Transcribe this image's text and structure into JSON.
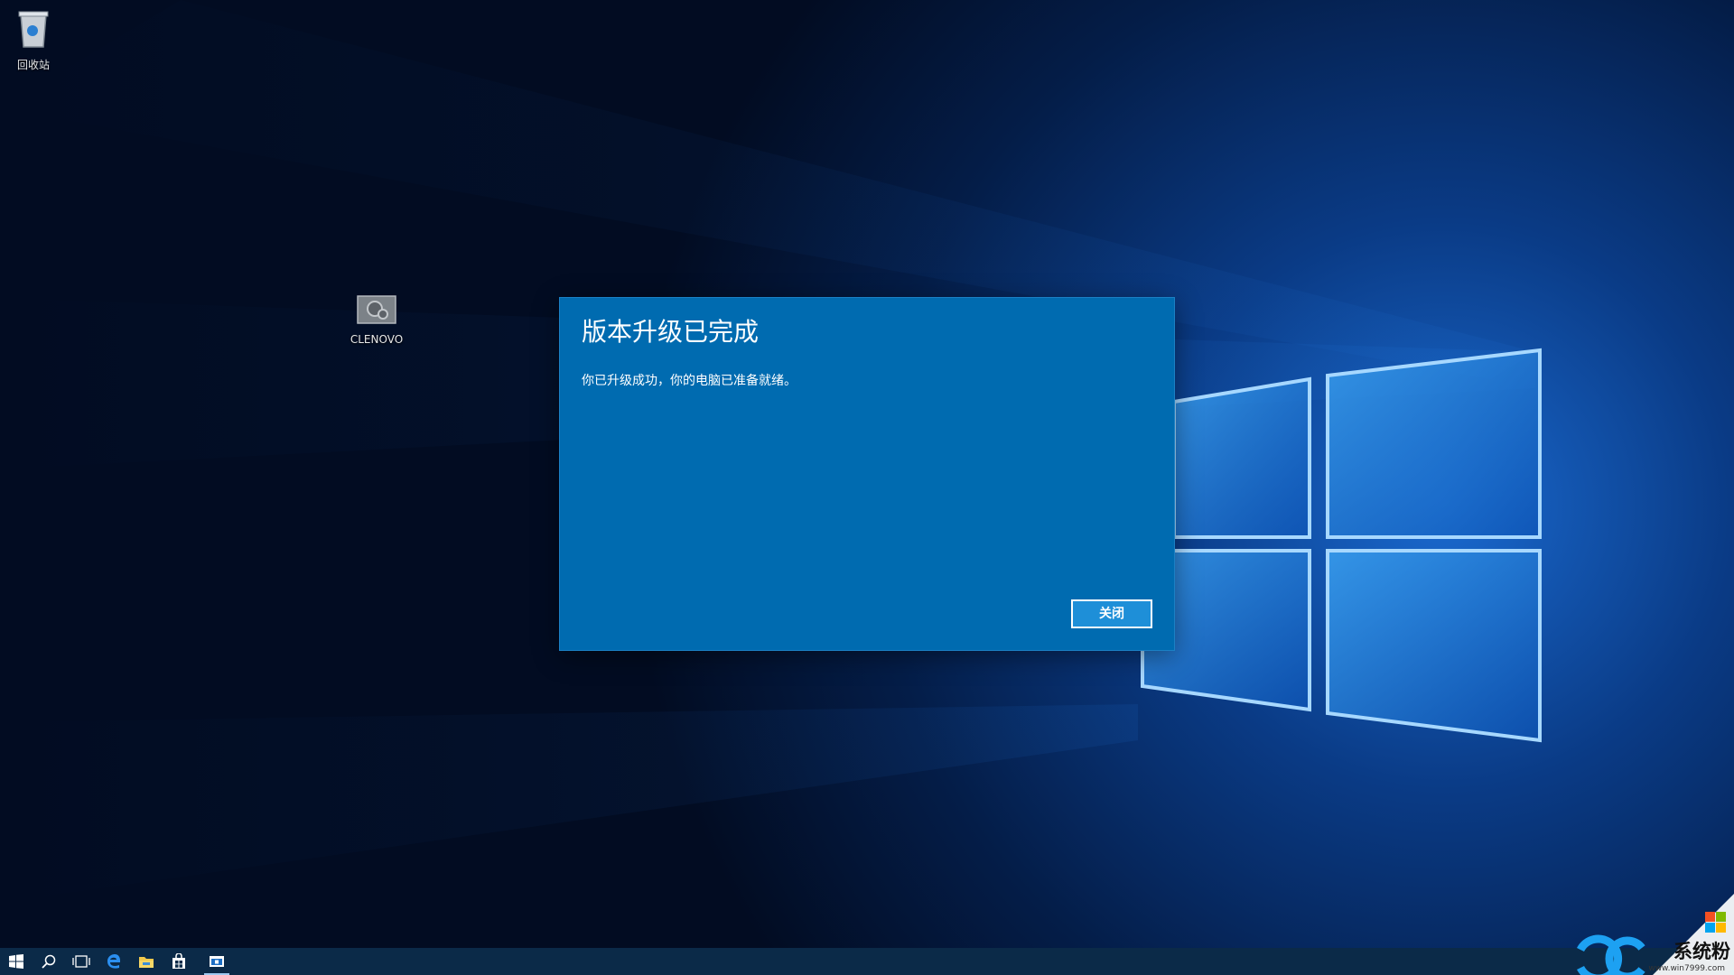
{
  "desktop": {
    "icons": [
      {
        "label": "回收站",
        "icon": "recycle-bin-icon"
      },
      {
        "label": "CLENOVO",
        "icon": "settings-drive-icon"
      }
    ]
  },
  "dialog": {
    "title": "版本升级已完成",
    "message": "你已升级成功，你的电脑已准备就绪。",
    "close_label": "关闭"
  },
  "taskbar": {
    "items": [
      "windows-start-icon",
      "search-icon",
      "task-view-icon",
      "edge-icon",
      "file-explorer-icon",
      "store-icon",
      "app-window-icon"
    ],
    "active_item": "app-window-icon"
  },
  "watermark": {
    "text": "系统粉",
    "url": "www.win7999.com"
  },
  "colors": {
    "dialog_bg": "#006bb0",
    "button_bg": "#1e8fd8",
    "taskbar_bg": "#0b2a48"
  }
}
